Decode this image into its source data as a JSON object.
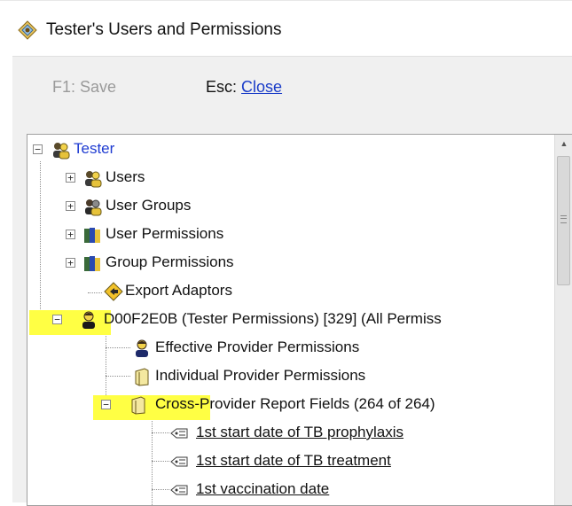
{
  "window": {
    "title": "Tester's Users and Permissions"
  },
  "toolbar": {
    "save_label": "F1: Save",
    "esc_key": "Esc:",
    "close_label": "Close"
  },
  "tree": {
    "root": {
      "label": "Tester",
      "expanded": true,
      "icon": "users-icon"
    },
    "nodes": [
      {
        "label": "Users",
        "expanded": false,
        "icon": "users-icon"
      },
      {
        "label": "User Groups",
        "expanded": false,
        "icon": "group-icon"
      },
      {
        "label": "User Permissions",
        "expanded": false,
        "icon": "permissions-book-icon"
      },
      {
        "label": "Group Permissions",
        "expanded": false,
        "icon": "permissions-book-icon"
      },
      {
        "label": "Export Adaptors",
        "icon": "adaptor-icon"
      },
      {
        "label": "D00F2E0B (Tester Permissions) [329] (All Permiss",
        "expanded": true,
        "icon": "user-icon"
      },
      {
        "label": "Effective Provider Permissions",
        "icon": "user-icon"
      },
      {
        "label": "Individual Provider Permissions",
        "icon": "book-icon"
      },
      {
        "label": "Cross-Provider Report Fields (264 of 264)",
        "expanded": true,
        "icon": "book-icon"
      },
      {
        "label": "1st start date of TB prophylaxis",
        "icon": "field-icon"
      },
      {
        "label": "1st start date of TB treatment",
        "icon": "field-icon"
      },
      {
        "label": "1st vaccination date",
        "icon": "field-icon"
      }
    ]
  },
  "colors": {
    "highlight": "#ffff44",
    "link": "#1a3cc8",
    "root_label": "#1e3bd1"
  }
}
